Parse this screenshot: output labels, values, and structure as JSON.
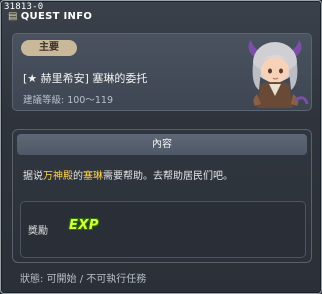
{
  "window": {
    "quest_code": "31813-0",
    "title": "QUEST INFO",
    "title_icon": "book-icon"
  },
  "header": {
    "category": "主要",
    "quest_name": "[★ 赫里希安] 塞琳的委托",
    "level_requirement": "建議等級: 100～119",
    "npc": "npc-portrait-seren"
  },
  "content": {
    "section_title": "內容",
    "description": {
      "part1": "据说",
      "highlight1": "万神殿",
      "part2": "的",
      "highlight2": "塞琳",
      "part3": "需要帮助。去帮助居民们吧。"
    },
    "reward": {
      "label": "獎勵",
      "icon_text": "EXP",
      "icon": "exp-icon"
    }
  },
  "status": {
    "text": "狀態: 可開始 / 不可執行任務"
  },
  "colors": {
    "highlight": "#ffd44a",
    "exp": "#d5ff3a",
    "badge": "#c9b99a"
  }
}
